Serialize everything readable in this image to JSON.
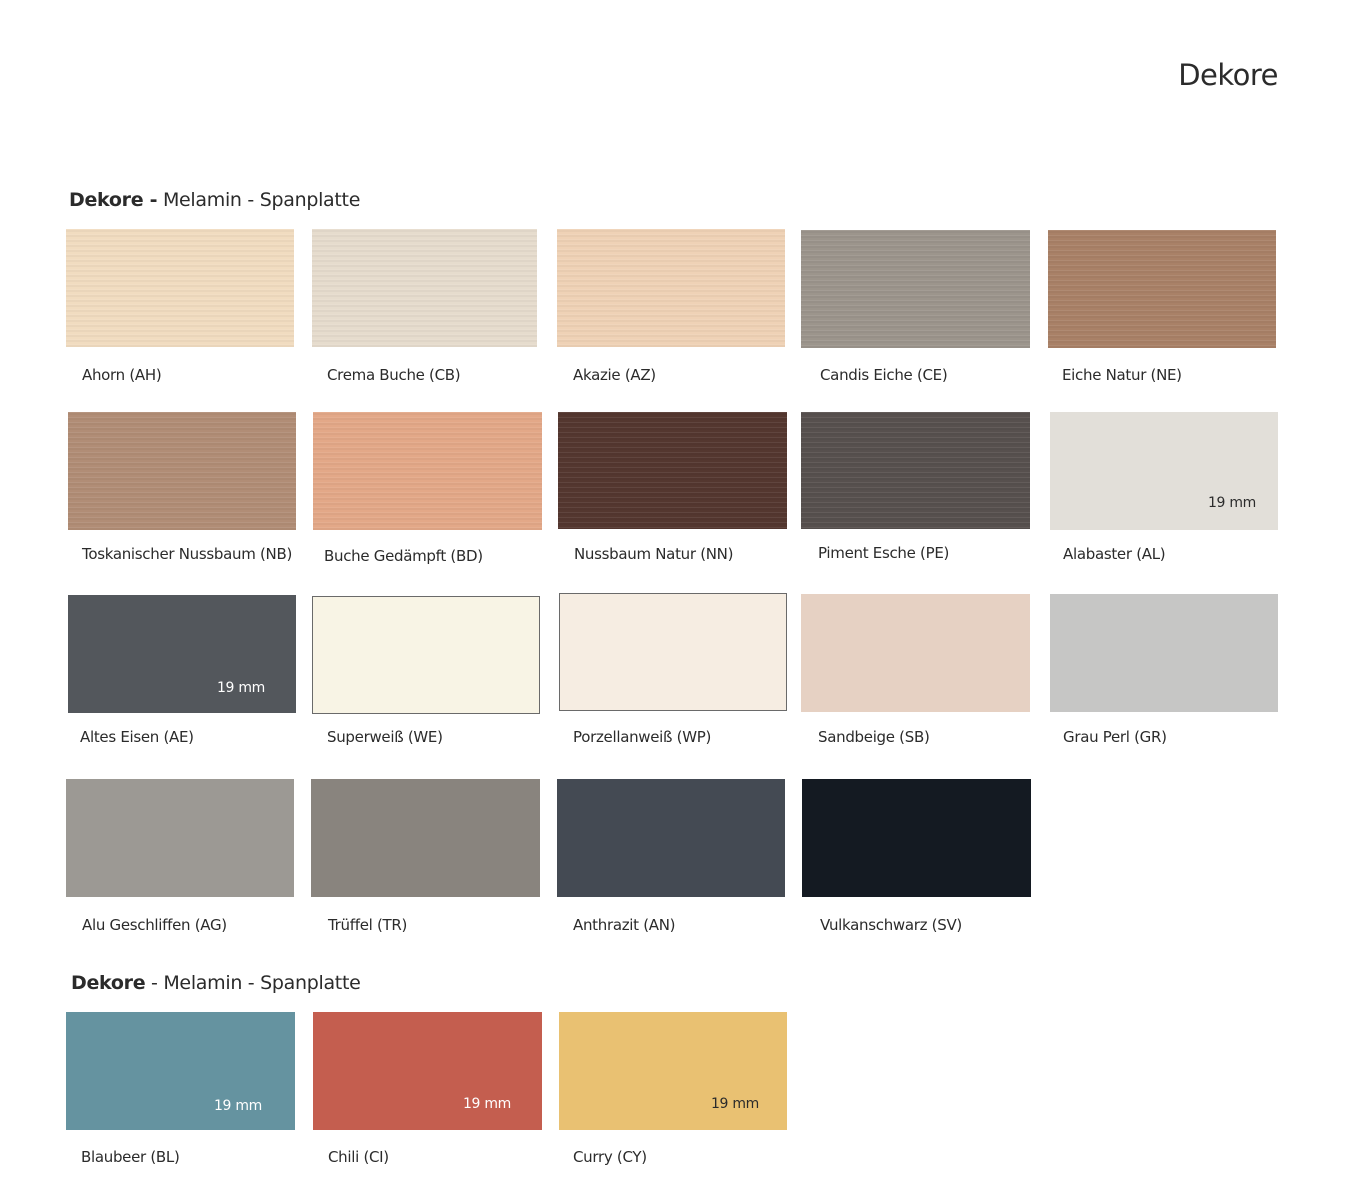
{
  "page_title": "Dekore",
  "section1": {
    "bold": "Dekore -",
    "rest": " Melamin - Spanplatte"
  },
  "section2": {
    "bold": "Dekore",
    "rest": " - Melamin - Spanplatte"
  },
  "swatches": [
    {
      "label": "Ahorn (AH)",
      "color": "#f1dcc0"
    },
    {
      "label": "Crema Buche (CB)",
      "color": "#e6dccd"
    },
    {
      "label": "Akazie (AZ)",
      "color": "#efd2b6"
    },
    {
      "label": "Candis Eiche (CE)",
      "color": "#9c958c"
    },
    {
      "label": "Eiche Natur (NE)",
      "color": "#a98167"
    },
    {
      "label": "Toskanischer Nussbaum (NB)",
      "color": "#b18d76"
    },
    {
      "label": "Buche Gedämpft (BD)",
      "color": "#e3a888"
    },
    {
      "label": "Nussbaum Natur (NN)",
      "color": "#54372f"
    },
    {
      "label": "Piment Esche (PE)",
      "color": "#57504e"
    },
    {
      "label": "Alabaster (AL)",
      "color": "#e2dfd9",
      "thickness": "19 mm"
    },
    {
      "label": "Altes Eisen (AE)",
      "color": "#53575c",
      "thickness": "19 mm"
    },
    {
      "label": "Superweiß (WE)",
      "color": "#f8f4e5"
    },
    {
      "label": "Porzellanweiß (WP)",
      "color": "#f6ede2"
    },
    {
      "label": "Sandbeige (SB)",
      "color": "#e6d1c3"
    },
    {
      "label": "Grau Perl (GR)",
      "color": "#c6c6c5"
    },
    {
      "label": "Alu Geschliffen (AG)",
      "color": "#9c9994"
    },
    {
      "label": "Trüffel (TR)",
      "color": "#89847e"
    },
    {
      "label": "Anthrazit (AN)",
      "color": "#444a53"
    },
    {
      "label": "Vulkanschwarz (SV)",
      "color": "#141a22"
    },
    {
      "label": "Blaubeer (BL)",
      "color": "#6593a0",
      "thickness": "19 mm"
    },
    {
      "label": "Chili (CI)",
      "color": "#c45e4f",
      "thickness": "19 mm"
    },
    {
      "label": "Curry (CY)",
      "color": "#e9c172",
      "thickness": "19 mm"
    }
  ]
}
